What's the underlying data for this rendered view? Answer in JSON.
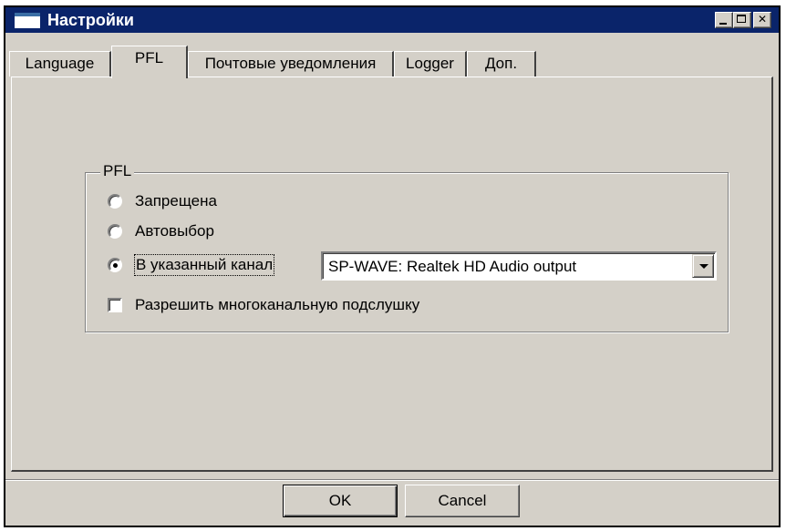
{
  "window": {
    "title": "Настройки"
  },
  "tabs": [
    {
      "label": "Language",
      "active": false
    },
    {
      "label": "PFL",
      "active": true
    },
    {
      "label": "Почтовые уведомления",
      "active": false
    },
    {
      "label": "Logger",
      "active": false
    },
    {
      "label": "Доп.",
      "active": false
    }
  ],
  "pfl_group": {
    "legend": "PFL",
    "options": [
      {
        "label": "Запрещена",
        "checked": false
      },
      {
        "label": "Автовыбор",
        "checked": false
      },
      {
        "label": "В указанный канал",
        "checked": true
      }
    ],
    "channel_select": {
      "value": "SP-WAVE: Realtek HD Audio output"
    },
    "multichannel_checkbox": {
      "label": "Разрешить многоканальную подслушку",
      "checked": false
    }
  },
  "buttons": {
    "ok": "OK",
    "cancel": "Cancel"
  }
}
